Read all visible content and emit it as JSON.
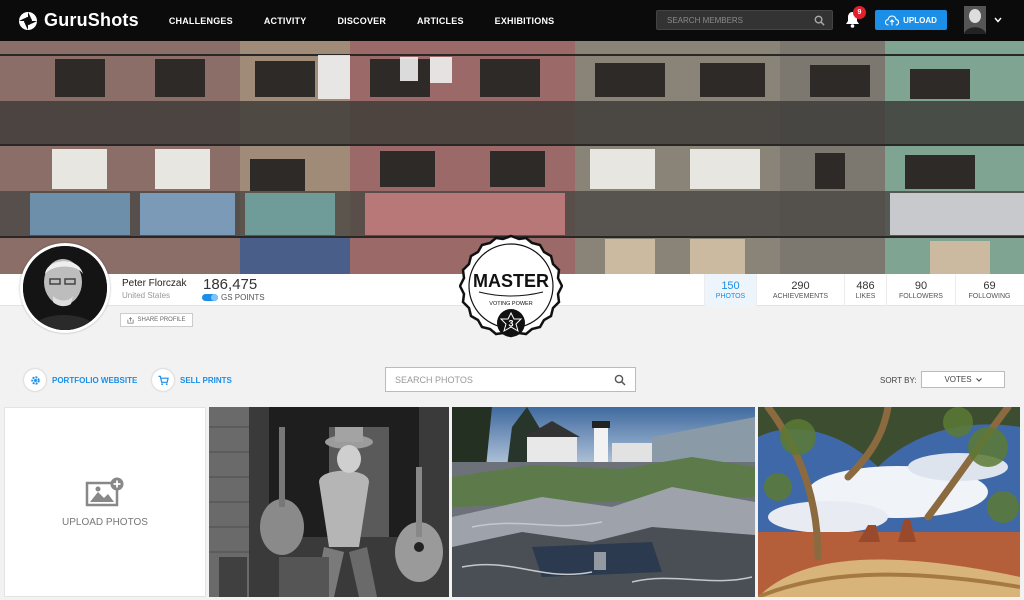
{
  "brand": {
    "name": "GuruShots"
  },
  "nav": {
    "items": [
      "CHALLENGES",
      "ACTIVITY",
      "DISCOVER",
      "ARTICLES",
      "EXHIBITIONS"
    ]
  },
  "header": {
    "search_placeholder": "SEARCH MEMBERS",
    "notification_count": "9",
    "upload_label": "UPLOAD"
  },
  "profile": {
    "name": "Peter Florczak",
    "location": "United States",
    "points": "186,475",
    "points_label": "GS POINTS",
    "share_label": "SHARE PROFILE",
    "level_badge": "MASTER",
    "badge_sub": "VOTING POWER",
    "badge_number": "3"
  },
  "stats": [
    {
      "value": "150",
      "label": "PHOTOS",
      "active": true
    },
    {
      "value": "290",
      "label": "ACHIEVEMENTS",
      "active": false
    },
    {
      "value": "486",
      "label": "LIKES",
      "active": false
    },
    {
      "value": "90",
      "label": "FOLLOWERS",
      "active": false
    },
    {
      "value": "69",
      "label": "FOLLOWING",
      "active": false
    }
  ],
  "toolbar": {
    "portfolio_label": "PORTFOLIO WEBSITE",
    "sell_label": "SELL PRINTS",
    "search_placeholder": "SEARCH PHOTOS",
    "sort_label": "SORT BY:",
    "sort_value": "VOTES"
  },
  "grid": {
    "upload_label": "UPLOAD PHOTOS"
  },
  "colors": {
    "accent": "#1b8ee8",
    "topbar": "#0b0b0b",
    "badge_red": "#e0202e"
  },
  "icons": [
    "gurushots-logo-icon",
    "search-icon",
    "bell-icon",
    "cloud-upload-icon",
    "chevron-down-icon",
    "share-icon",
    "gear-icon",
    "cart-icon",
    "image-add-icon"
  ]
}
